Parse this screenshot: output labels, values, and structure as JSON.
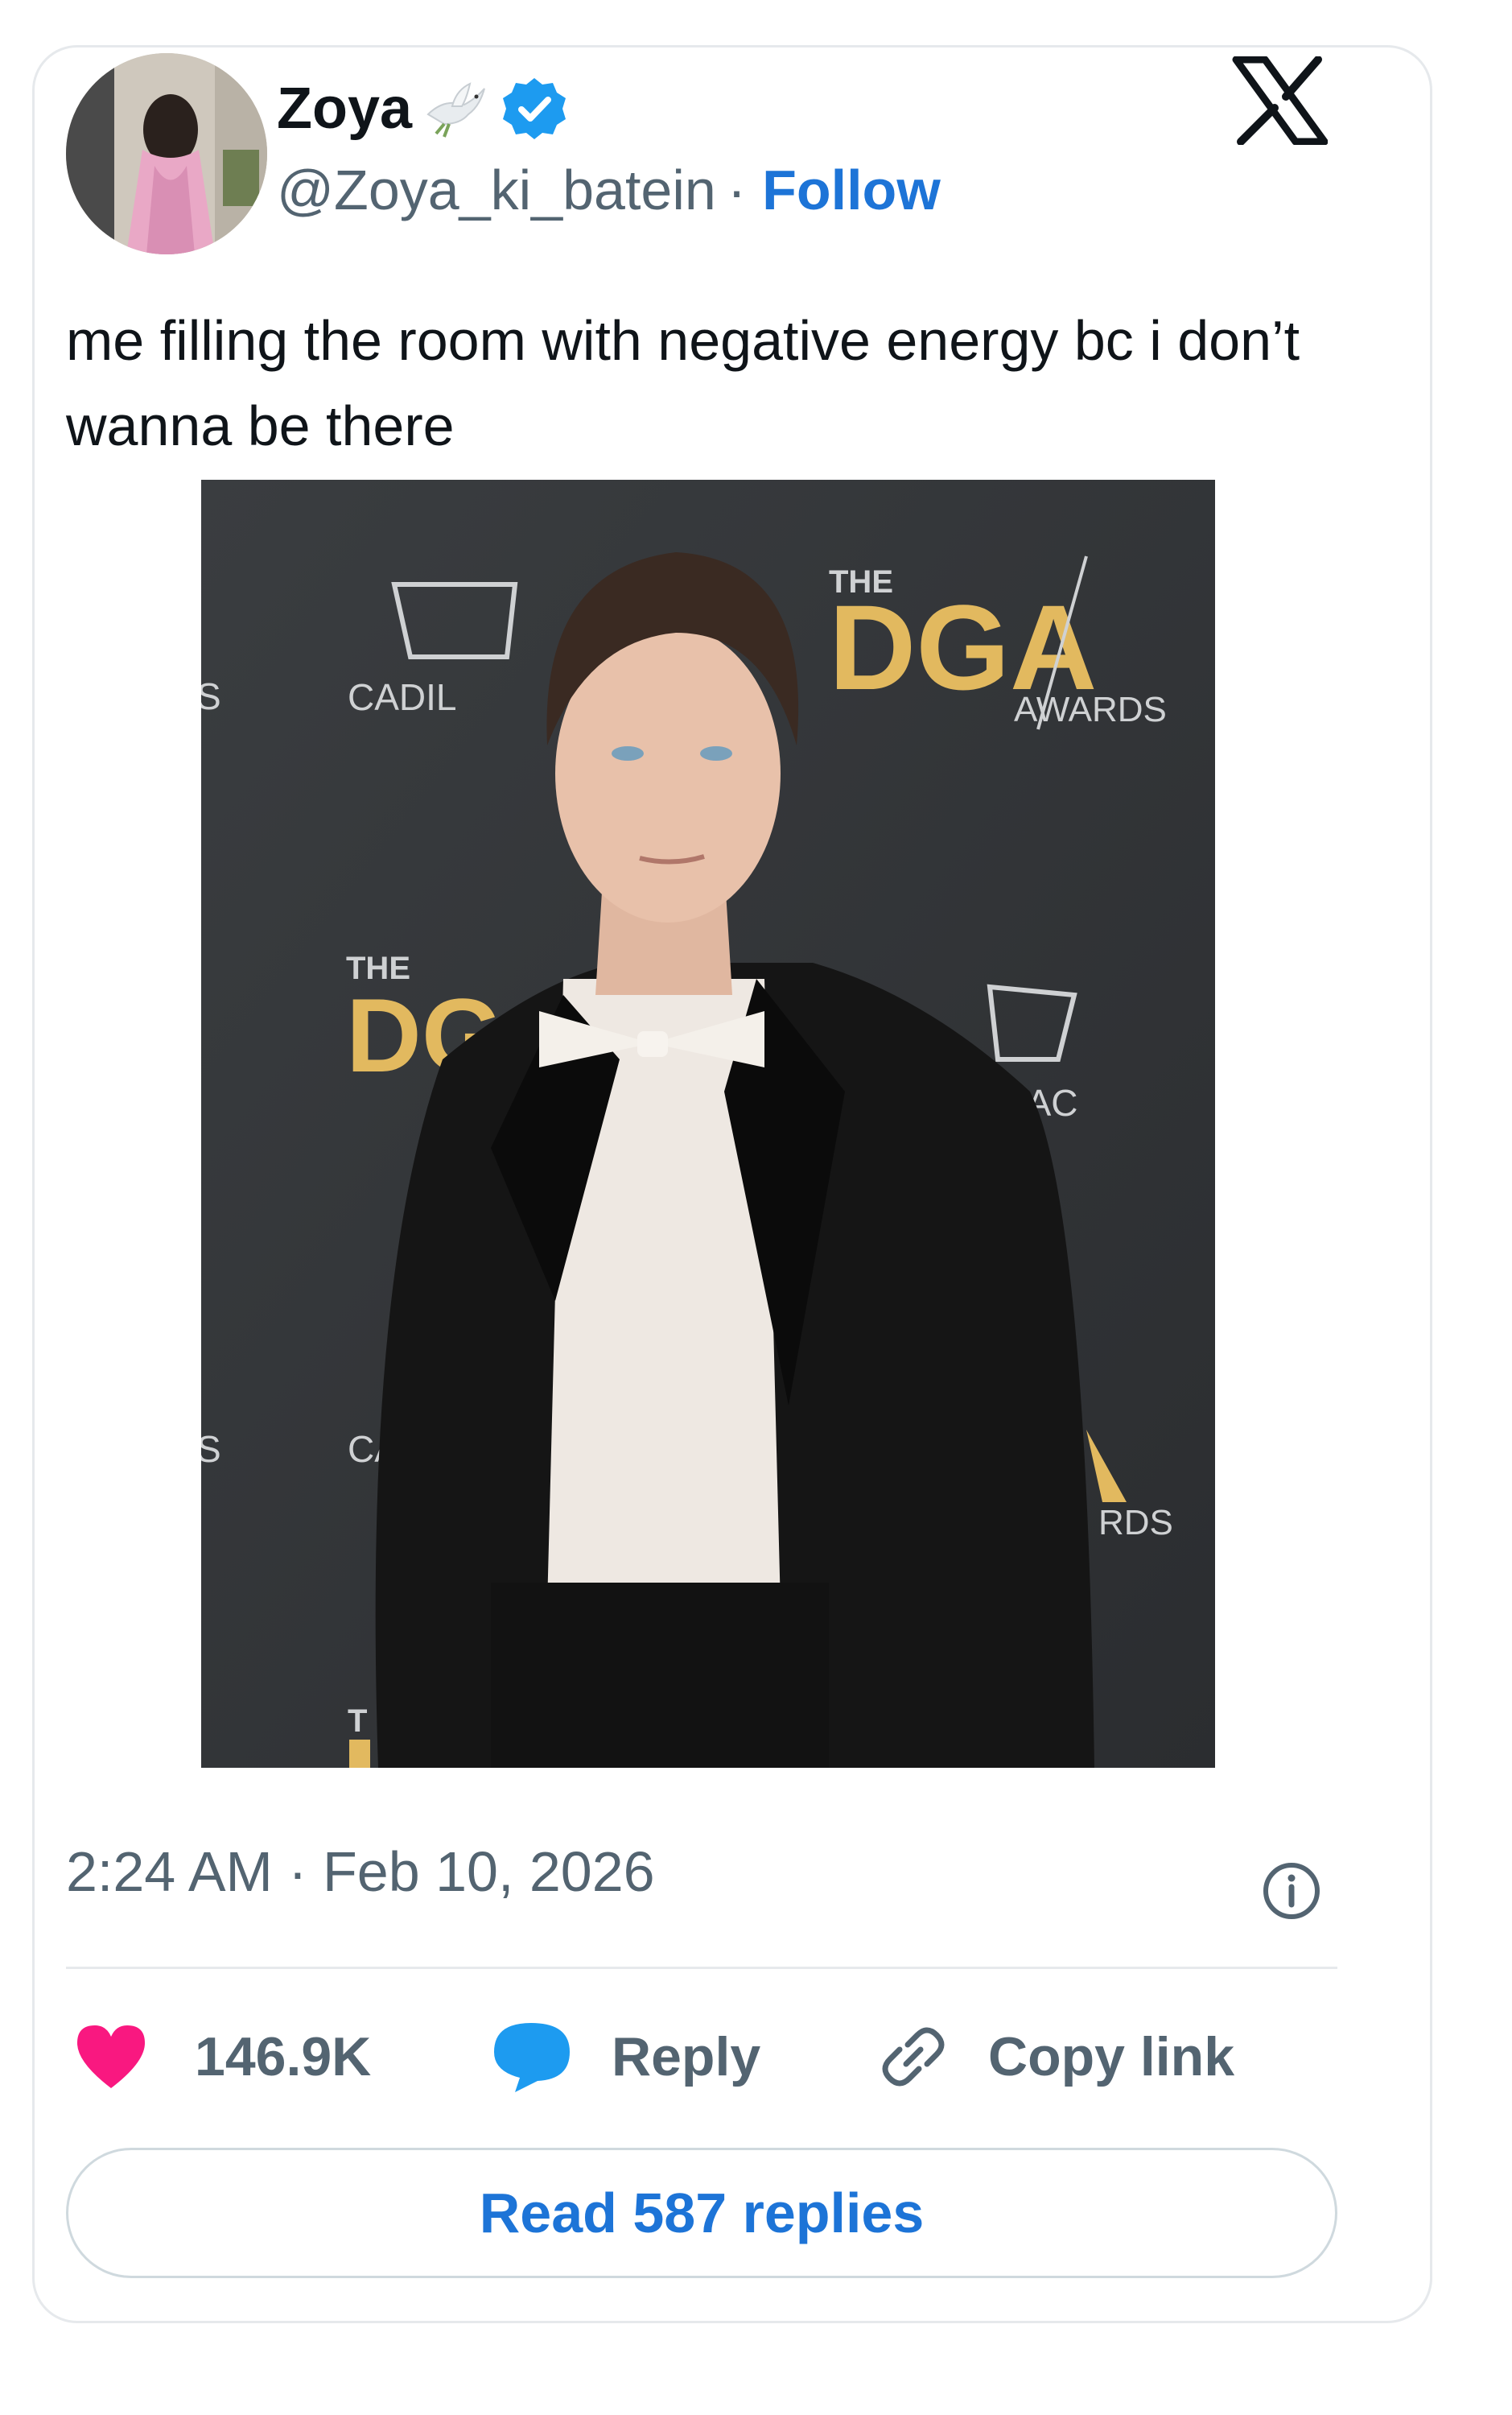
{
  "author": {
    "display_name": "Zoya",
    "handle": "@Zoya_ki_batein",
    "separator": "·",
    "follow_label": "Follow",
    "verified_color": "#1d9bf0",
    "name_emoji": "dove-icon"
  },
  "tweet": {
    "text": "me filling the room with negative energy bc i don’t wanna be there"
  },
  "media": {
    "backdrop_texts": {
      "the_top": "THE",
      "dga_top": "DGA",
      "awards_top": "AWARDS",
      "cadillac_top": "CADIL",
      "the_mid": "THE",
      "dga_mid": "DG",
      "lac_mid": "LAC",
      "s_left_top": "S",
      "s_left_bottom": "S",
      "ca_bottom": "CA",
      "rds_bottom": "RDS",
      "t_bottom": "T"
    },
    "accent_color": "#e2b95f"
  },
  "meta": {
    "timestamp": "2:24 AM · Feb 10, 2026"
  },
  "actions": {
    "likes_count": "146.9K",
    "reply_label": "Reply",
    "copy_link_label": "Copy link",
    "read_replies_label": "Read 587 replies",
    "like_color": "#f91880",
    "reply_color": "#1d9bf0",
    "link_color": "#1d74d7"
  }
}
